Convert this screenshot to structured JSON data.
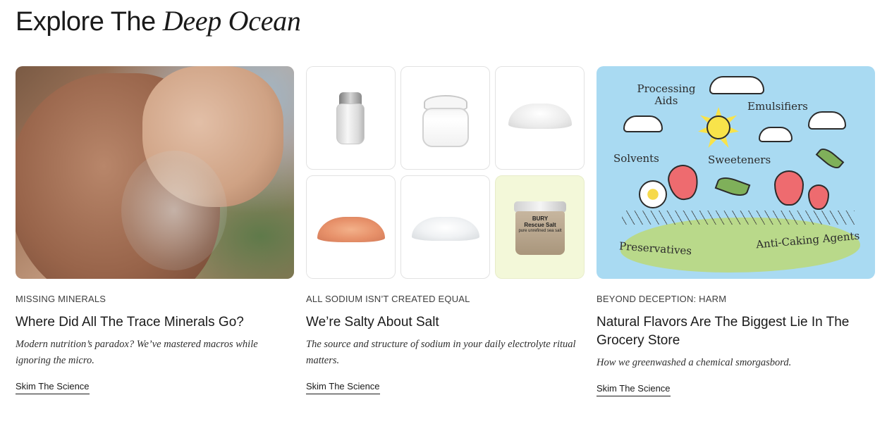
{
  "section": {
    "heading_plain": "Explore The",
    "heading_italic": "Deep Ocean"
  },
  "cards": [
    {
      "kicker": "MISSING MINERALS",
      "title": "Where Did All The Trace Minerals Go?",
      "dek": "Modern nutrition’s paradox? We’ve mastered macros while ignoring the micro.",
      "cta": "Skim The Science"
    },
    {
      "kicker": "ALL SODIUM ISN’T CREATED EQUAL",
      "title": "We’re Salty About Salt",
      "dek": "The source and structure of sodium in your daily electrolyte ritual matters.",
      "cta": "Skim The Science",
      "tub_label": {
        "brand": "BURY",
        "name": "Rescue Salt",
        "sub": "pure unrefined sea salt"
      }
    },
    {
      "kicker": "BEYOND DECEPTION: HARM",
      "title": "Natural Flavors Are The Biggest Lie In The Grocery Store",
      "dek": "How we greenwashed a chemical smorgasbord.",
      "cta": "Skim The Science",
      "illustration_words": {
        "processing_aids": "Processing Aids",
        "emulsifiers": "Emulsifiers",
        "solvents": "Solvents",
        "sweeteners": "Sweeteners",
        "preservatives": "Preservatives",
        "anti_caking": "Anti-Caking Agents"
      }
    }
  ],
  "colors": {
    "text": "#1a1a1a",
    "illustration_sky": "#a9daf2",
    "tile_highlight": "#f3f8d9"
  }
}
